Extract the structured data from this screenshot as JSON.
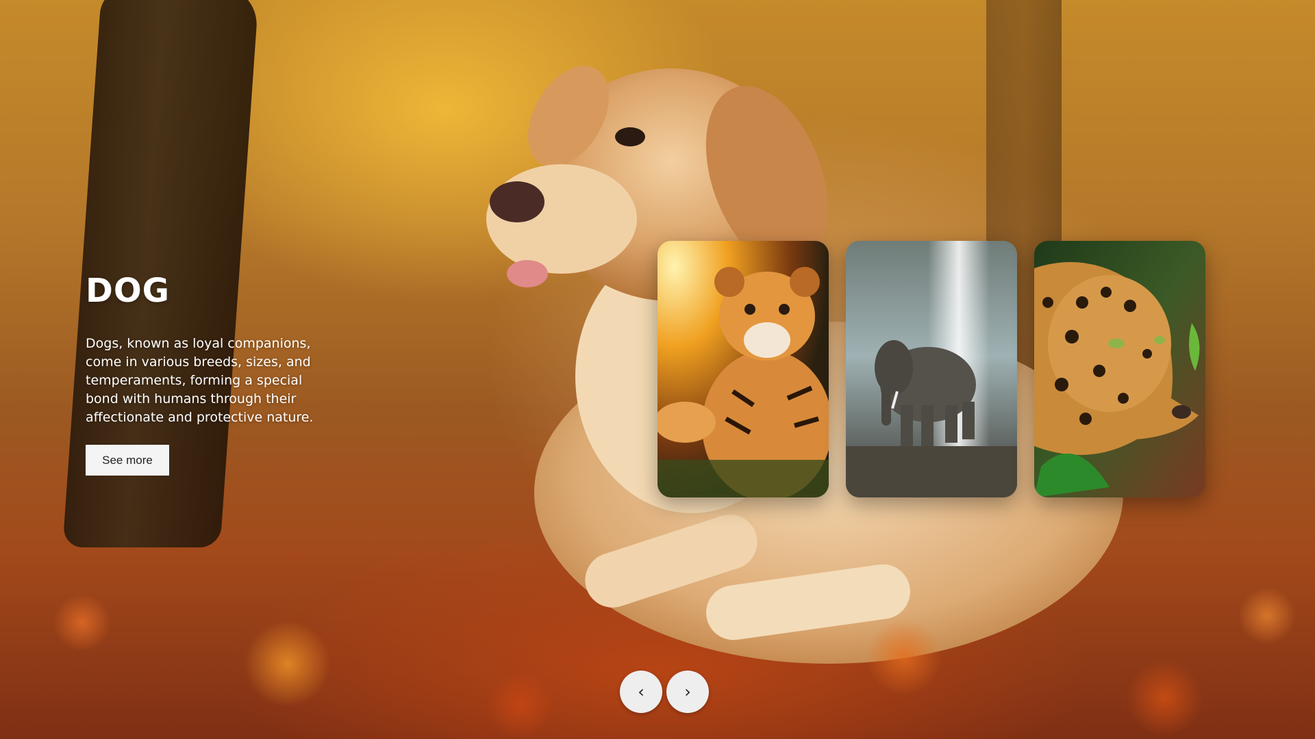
{
  "hero": {
    "title": "DOG",
    "description": "Dogs, known as loyal companions, come in various breeds, sizes, and temperaments, forming a special bond with humans through their affectionate and protective nature.",
    "button_label": "See more",
    "background_subject": "golden retriever in autumn forest"
  },
  "thumbnails": [
    {
      "subject": "tiger cub",
      "icon": "tiger-image"
    },
    {
      "subject": "elephant",
      "icon": "elephant-image"
    },
    {
      "subject": "leopard",
      "icon": "leopard-image"
    }
  ],
  "navigation": {
    "prev_glyph": "‹",
    "next_glyph": "›",
    "prev_icon": "chevron-left-icon",
    "next_icon": "chevron-right-icon"
  },
  "colors": {
    "text": "#ffffff",
    "button_bg": "#f4f4f4",
    "arrow_bg": "#eeeeee"
  }
}
